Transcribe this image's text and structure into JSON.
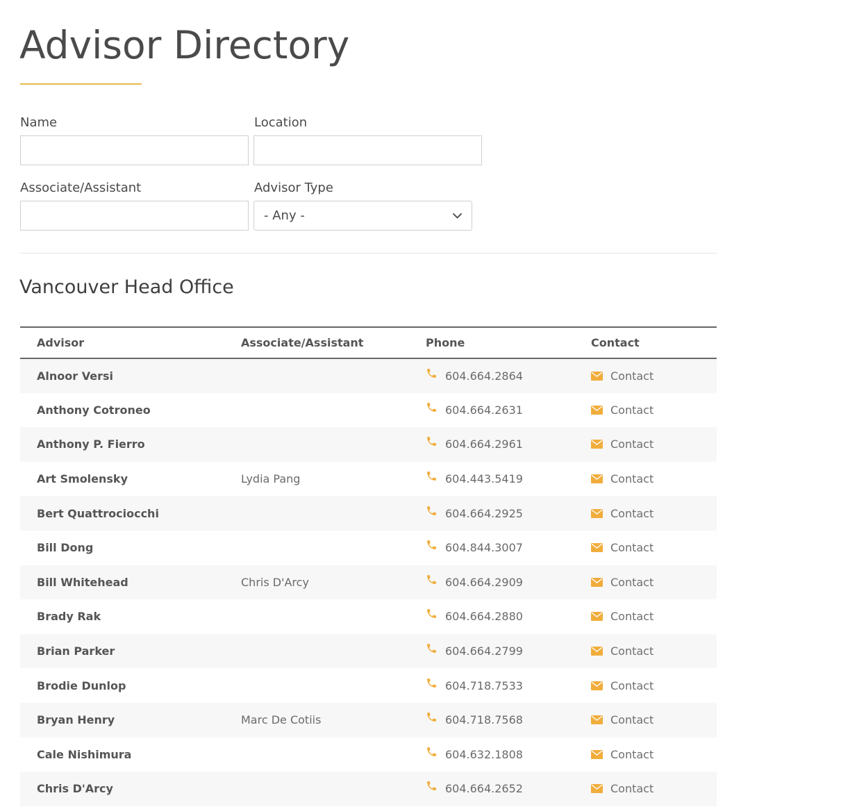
{
  "header": {
    "title": "Advisor Directory"
  },
  "filters": {
    "name_label": "Name",
    "name_value": "",
    "location_label": "Location",
    "location_value": "",
    "associate_label": "Associate/Assistant",
    "associate_value": "",
    "advisor_type_label": "Advisor Type",
    "advisor_type_selected": "- Any -"
  },
  "section": {
    "title": "Vancouver Head Office"
  },
  "table": {
    "columns": [
      "Advisor",
      "Associate/Assistant",
      "Phone",
      "Contact"
    ],
    "rows": [
      {
        "advisor": "Alnoor Versi",
        "associate": "",
        "phone": "604.664.2864",
        "contact": "Contact"
      },
      {
        "advisor": "Anthony Cotroneo",
        "associate": "",
        "phone": "604.664.2631",
        "contact": "Contact"
      },
      {
        "advisor": "Anthony P. Fierro",
        "associate": "",
        "phone": "604.664.2961",
        "contact": "Contact"
      },
      {
        "advisor": "Art Smolensky",
        "associate": "Lydia Pang",
        "phone": "604.443.5419",
        "contact": "Contact"
      },
      {
        "advisor": "Bert Quattrociocchi",
        "associate": "",
        "phone": "604.664.2925",
        "contact": "Contact"
      },
      {
        "advisor": "Bill Dong",
        "associate": "",
        "phone": "604.844.3007",
        "contact": "Contact"
      },
      {
        "advisor": "Bill Whitehead",
        "associate": "Chris D'Arcy",
        "phone": "604.664.2909",
        "contact": "Contact"
      },
      {
        "advisor": "Brady Rak",
        "associate": "",
        "phone": "604.664.2880",
        "contact": "Contact"
      },
      {
        "advisor": "Brian Parker",
        "associate": "",
        "phone": "604.664.2799",
        "contact": "Contact"
      },
      {
        "advisor": "Brodie Dunlop",
        "associate": "",
        "phone": "604.718.7533",
        "contact": "Contact"
      },
      {
        "advisor": "Bryan Henry",
        "associate": "Marc De Cotiis",
        "phone": "604.718.7568",
        "contact": "Contact"
      },
      {
        "advisor": "Cale Nishimura",
        "associate": "",
        "phone": "604.632.1808",
        "contact": "Contact"
      },
      {
        "advisor": "Chris D'Arcy",
        "associate": "",
        "phone": "604.664.2652",
        "contact": "Contact"
      }
    ]
  },
  "icons": {
    "phone": "phone-icon",
    "mail": "envelope-icon",
    "dropdown": "chevron-down-icon"
  },
  "colors": {
    "accent": "#e9b94a",
    "icon": "#f0ad3c",
    "row_stripe": "#f7f7f7",
    "text": "#555555"
  }
}
